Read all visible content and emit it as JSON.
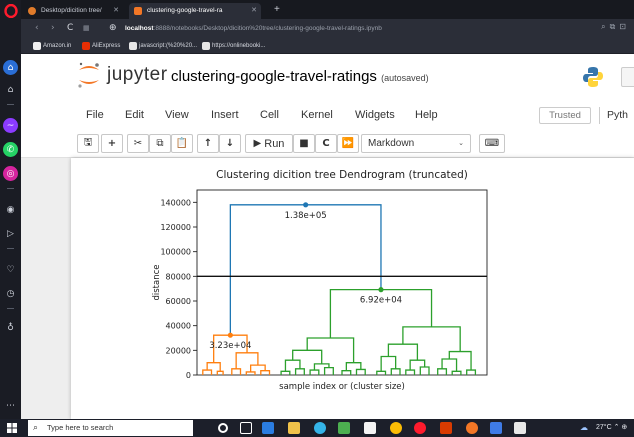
{
  "browser": {
    "tabs": [
      {
        "label": "Desktop/dicition tree/",
        "favicon_color": "#e07b2a"
      },
      {
        "label": "clustering-google-travel-ra",
        "favicon_color": "#f37726"
      }
    ],
    "url_host": "localhost",
    "url_path": ":8888/notebooks/Desktop/dicition%20tree/clustering-google-travel-ratings.ipynb",
    "bookmarks": [
      {
        "label": "Amazon.in",
        "color": "#f0f0f0"
      },
      {
        "label": "AliExpress",
        "color": "#e62e04"
      },
      {
        "label": "javascript:(%20%20...",
        "color": "#e6e6e6"
      },
      {
        "label": "https://onlinebooki...",
        "color": "#e6e6e6"
      }
    ]
  },
  "jupyter": {
    "brand": "jupyter",
    "notebook_title": "clustering-google-travel-ratings",
    "save_status": "(autosaved)",
    "menu": [
      "File",
      "Edit",
      "View",
      "Insert",
      "Cell",
      "Kernel",
      "Widgets",
      "Help"
    ],
    "trusted_label": "Trusted",
    "kernel_label": "Pyth",
    "toolbar": {
      "run_label": "Run",
      "cell_type": "Markdown"
    }
  },
  "chart_data": {
    "type": "dendrogram",
    "title": "Clustering dicition tree Dendrogram (truncated)",
    "xlabel": "sample index or (cluster size)",
    "ylabel": "distance",
    "ylim": [
      0,
      150000
    ],
    "yticks": [
      0,
      20000,
      40000,
      60000,
      80000,
      100000,
      120000,
      140000
    ],
    "ytick_labels": [
      "0",
      "20000",
      "40000",
      "60000",
      "80000",
      "100000",
      "120000",
      "140000"
    ],
    "cutoff_line": 80000,
    "grid": false,
    "legend": "none",
    "merges": [
      {
        "height": 138000,
        "label": "1.38e+05",
        "color": "#1f77b4"
      },
      {
        "height": 69200,
        "label": "6.92e+04",
        "color": "#2ca02c"
      },
      {
        "height": 32300,
        "label": "3.23e+04",
        "color": "#ff7f0e"
      }
    ],
    "colors": {
      "left": "#ff7f0e",
      "right": "#2ca02c",
      "top": "#1f77b4"
    }
  },
  "taskbar": {
    "search_placeholder": "Type here to search",
    "temperature": "27°C"
  }
}
